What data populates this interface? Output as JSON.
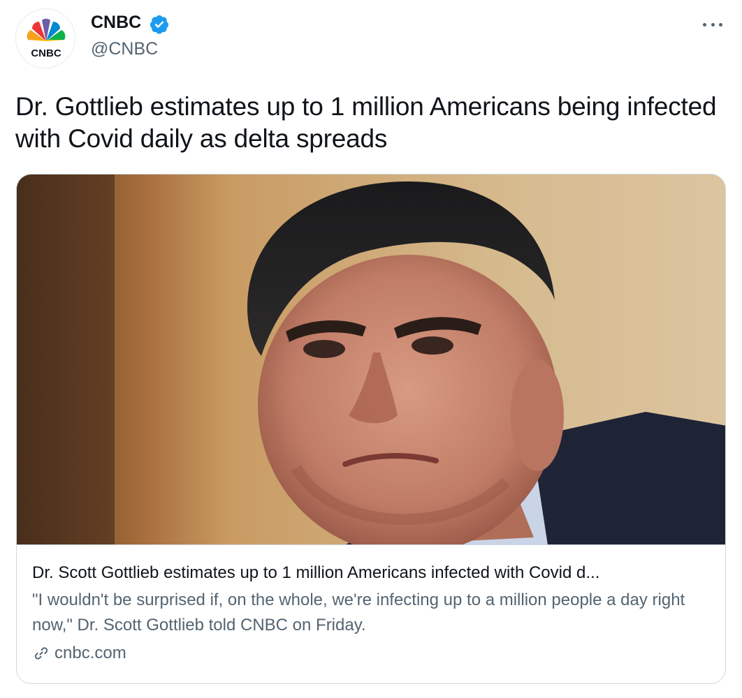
{
  "author": {
    "name": "CNBC",
    "handle": "@CNBC",
    "verified": true,
    "logo_text": "CNBC"
  },
  "tweet": {
    "text": "Dr. Gottlieb estimates up to 1 million Americans being infected with Covid daily as delta spreads"
  },
  "card": {
    "title": "Dr. Scott Gottlieb estimates up to 1 million Americans infected with Covid d...",
    "description": "\"I wouldn't be surprised if, on the whole, we're infecting up to a million people a day right now,\" Dr. Scott Gottlieb told CNBC on Friday.",
    "domain": "cnbc.com"
  },
  "icons": {
    "verified": "verified-badge-icon",
    "more": "more-options-icon",
    "link": "link-icon"
  },
  "colors": {
    "verified_blue": "#1d9bf0",
    "secondary_text": "#536471",
    "border": "#cfd9de"
  }
}
